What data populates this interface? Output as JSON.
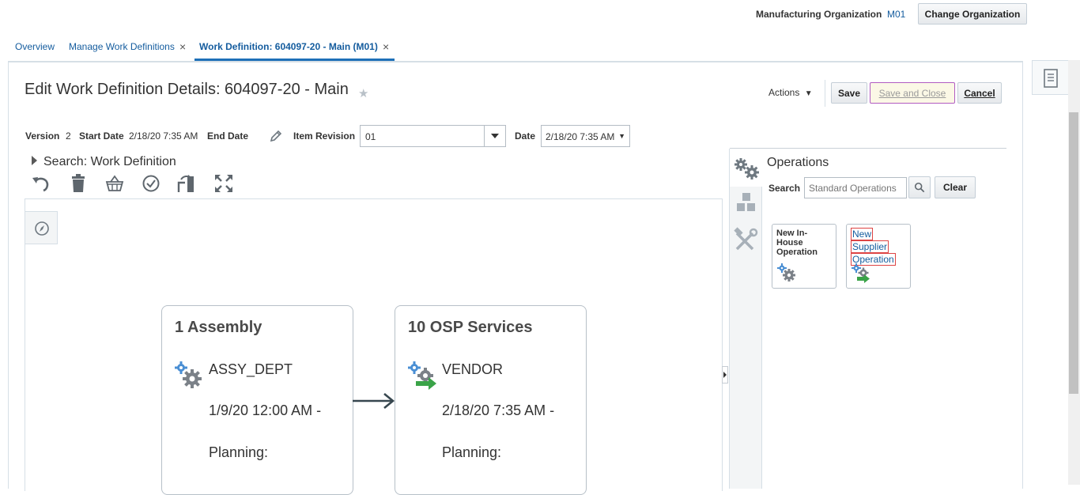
{
  "topbar": {
    "org_label": "Manufacturing Organization",
    "org_value": "M01",
    "change_org_label": "Change Organization"
  },
  "tabs": [
    {
      "label": "Overview",
      "closable": false
    },
    {
      "label": "Manage Work Definitions",
      "closable": true
    },
    {
      "label": "Work Definition: 604097-20 - Main (M01)",
      "closable": true,
      "active": true
    }
  ],
  "tab_close_glyph": "×",
  "header": {
    "title": "Edit Work Definition Details: 604097-20 - Main",
    "actions_label": "Actions",
    "save_label": "Save",
    "save_close_label": "Save and Close",
    "cancel_label": "Cancel"
  },
  "info": {
    "version_label": "Version",
    "version_value": "2",
    "start_date_label": "Start Date",
    "start_date_value": "2/18/20 7:35 AM",
    "end_date_label": "End Date",
    "item_revision_label": "Item Revision",
    "item_revision_value": "01",
    "date_label": "Date",
    "date_value": "2/18/20 7:35 AM"
  },
  "search_section": {
    "title": "Search: Work Definition"
  },
  "operations": [
    {
      "title": "1 Assembly",
      "department": "ASSY_DEPT",
      "date": "1/9/20 12:00 AM -",
      "planning": "Planning:",
      "type": "in-house"
    },
    {
      "title": "10 OSP Services",
      "department": "VENDOR",
      "date": "2/18/20 7:35 AM -",
      "planning": "Planning:",
      "type": "supplier"
    }
  ],
  "ops_panel": {
    "title": "Operations",
    "search_label": "Search",
    "search_placeholder": "Standard Operations",
    "clear_label": "Clear",
    "palette": [
      {
        "label": "New In-House Operation"
      },
      {
        "label_lines": [
          "New",
          "Supplier",
          "Operation"
        ]
      }
    ]
  },
  "colors": {
    "link": "#145c9e",
    "active_tab": "#1e70b8",
    "gear_blue": "#4a8fd4",
    "gear_gray": "#7b8188",
    "arrow_green": "#3aa348"
  }
}
